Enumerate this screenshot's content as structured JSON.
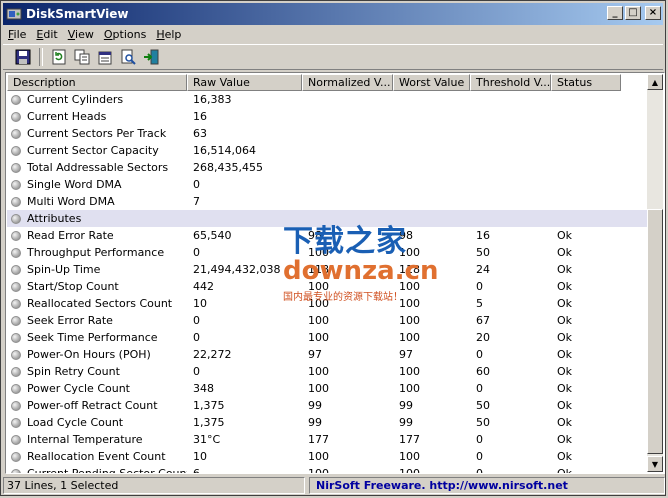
{
  "window": {
    "title": "DiskSmartView",
    "min_label": "_",
    "max_label": "□",
    "close_label": "×"
  },
  "menu": [
    {
      "label": "File",
      "key": "F",
      "rest": "ile"
    },
    {
      "label": "Edit",
      "key": "E",
      "rest": "dit"
    },
    {
      "label": "View",
      "key": "V",
      "rest": "iew"
    },
    {
      "label": "Options",
      "key": "O",
      "rest": "ptions"
    },
    {
      "label": "Help",
      "key": "H",
      "rest": "elp"
    }
  ],
  "toolbar": [
    "save-icon",
    "refresh-icon",
    "copy-icon",
    "properties-icon",
    "find-icon",
    "exit-icon"
  ],
  "columns": [
    "Description",
    "Raw Value",
    "Normalized V...",
    "Worst Value",
    "Threshold V...",
    "Status"
  ],
  "rows": [
    [
      "Current Cylinders",
      "16,383",
      "",
      "",
      "",
      ""
    ],
    [
      "Current Heads",
      "16",
      "",
      "",
      "",
      ""
    ],
    [
      "Current Sectors Per Track",
      "63",
      "",
      "",
      "",
      ""
    ],
    [
      "Current Sector Capacity",
      "16,514,064",
      "",
      "",
      "",
      ""
    ],
    [
      "Total Addressable Sectors",
      "268,435,455",
      "",
      "",
      "",
      ""
    ],
    [
      "Single Word DMA",
      "0",
      "",
      "",
      "",
      ""
    ],
    [
      "Multi Word DMA",
      "7",
      "",
      "",
      "",
      ""
    ],
    [
      "Attributes",
      "",
      "",
      "",
      "",
      ""
    ],
    [
      "Read Error Rate",
      "65,540",
      "98",
      "98",
      "16",
      "Ok"
    ],
    [
      "Throughput Performance",
      "0",
      "100",
      "100",
      "50",
      "Ok"
    ],
    [
      "Spin-Up Time",
      "21,494,432,038",
      "118",
      "118",
      "24",
      "Ok"
    ],
    [
      "Start/Stop Count",
      "442",
      "100",
      "100",
      "0",
      "Ok"
    ],
    [
      "Reallocated Sectors Count",
      "10",
      "100",
      "100",
      "5",
      "Ok"
    ],
    [
      "Seek Error Rate",
      "0",
      "100",
      "100",
      "67",
      "Ok"
    ],
    [
      "Seek Time Performance",
      "0",
      "100",
      "100",
      "20",
      "Ok"
    ],
    [
      "Power-On Hours (POH)",
      "22,272",
      "97",
      "97",
      "0",
      "Ok"
    ],
    [
      "Spin Retry Count",
      "0",
      "100",
      "100",
      "60",
      "Ok"
    ],
    [
      "Power Cycle Count",
      "348",
      "100",
      "100",
      "0",
      "Ok"
    ],
    [
      "Power-off Retract Count",
      "1,375",
      "99",
      "99",
      "50",
      "Ok"
    ],
    [
      "Load Cycle Count",
      "1,375",
      "99",
      "99",
      "50",
      "Ok"
    ],
    [
      "Internal Temperature",
      "31°C",
      "177",
      "177",
      "0",
      "Ok"
    ],
    [
      "Reallocation Event Count",
      "10",
      "100",
      "100",
      "0",
      "Ok"
    ],
    [
      "Current Pending Sector Count",
      "6",
      "100",
      "100",
      "0",
      "Ok"
    ]
  ],
  "selected_row": 7,
  "status": {
    "count": "37 Lines, 1 Selected",
    "credit": "NirSoft Freeware.  http://www.nirsoft.net"
  },
  "watermark": {
    "cn": "下载之家",
    "en": "downza.cn",
    "sub": "国内最专业的资源下载站！"
  },
  "colors": {
    "title_start": "#0a246a",
    "selection": "#e0e0f0",
    "credit_text": "#0000a0"
  }
}
